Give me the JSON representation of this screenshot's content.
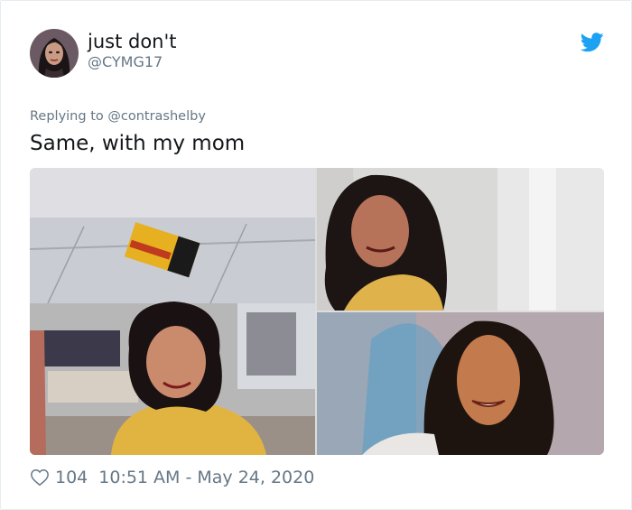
{
  "user": {
    "display_name": "just don't",
    "handle": "@CYMG17"
  },
  "tweet": {
    "replying_to": "Replying to @contrashelby",
    "text": "Same, with my mom"
  },
  "footer": {
    "likes": "104",
    "timestamp": "10:51 AM - May 24, 2020"
  },
  "colors": {
    "text": "#14171a",
    "secondary": "#657786",
    "brand": "#1da1f2"
  },
  "icons": {
    "brand": "twitter-bird-icon",
    "like": "heart-outline-icon"
  }
}
